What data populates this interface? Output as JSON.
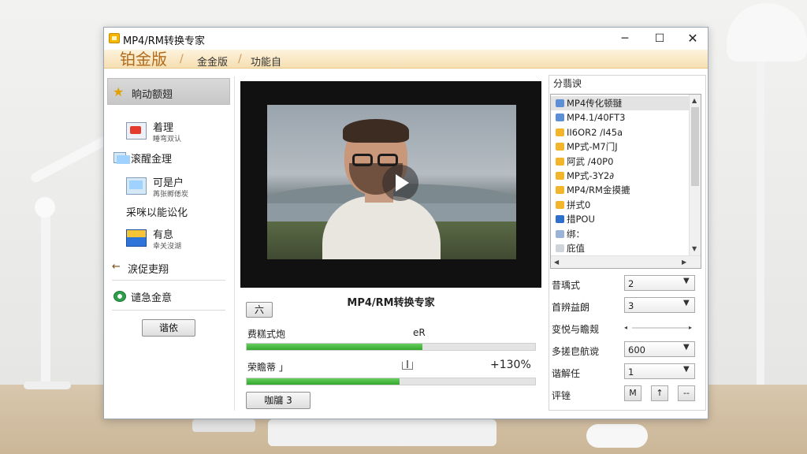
{
  "window": {
    "title": "MP4/RM转换专家",
    "min_glyph": "─",
    "max_glyph": "☐",
    "close_glyph": "✕"
  },
  "edition_bar": {
    "main_label": "铂金版",
    "tabs": [
      "金金版",
      "功能自"
    ]
  },
  "sidebar": {
    "top_label": "晌动额翅",
    "items": [
      {
        "label": "着理",
        "sub": "睡弯双认",
        "icon": "mail-icon"
      },
      {
        "label": "滚醒金理",
        "icon": "screen-small-icon"
      },
      {
        "label": "可是户",
        "sub": "苒张孵僁炭",
        "icon": "user-screen-icon"
      },
      {
        "label": "采咪以能讼化"
      },
      {
        "label": "有息",
        "sub": "幸关沒湖",
        "icon": "box-icon"
      },
      {
        "label": "涙促吏翔",
        "icon": "arrow-left-icon"
      },
      {
        "label": "谴急金意",
        "icon": "green-circle-icon"
      }
    ],
    "button_label": "谐依"
  },
  "center": {
    "video_title": "MP4/RM转换专家",
    "small_button": "六",
    "row1_label": "费糕式炮",
    "row1_value": "eR",
    "row1_progress": 0.61,
    "row2_label": "荣瞻蒂 」",
    "row2_value": "+130%",
    "row2_progress": 0.53,
    "bottom_button": "咖牖 3"
  },
  "right_panel": {
    "title": "分翡谀",
    "list": [
      {
        "label": "MP4传化顿翴",
        "icon_color": "#5c8fd6",
        "selected": true
      },
      {
        "label": "MP4.1/40FT3",
        "icon_color": "#5c8fd6"
      },
      {
        "label": "II6OR2 /I45a",
        "icon_color": "#f2b52c"
      },
      {
        "label": "MP式-M7门J",
        "icon_color": "#f2b52c"
      },
      {
        "label": "阿武 /40P0",
        "icon_color": "#f2b52c"
      },
      {
        "label": "MP式-3Y2∂",
        "icon_color": "#f2b52c"
      },
      {
        "label": "MP4/RM金摸摝",
        "icon_color": "#f2b52c"
      },
      {
        "label": "拼式0",
        "icon_color": "#f2b52c"
      },
      {
        "label": "措POU",
        "icon_color": "#2f6fcc"
      },
      {
        "label": "绑：",
        "icon_color": "#9ab3d6"
      },
      {
        "label": "庇值",
        "icon_color": "#cfd4da"
      }
    ],
    "fields": [
      {
        "label": "昔瑀式",
        "value": "2"
      },
      {
        "label": "首辨益朗",
        "value": "3"
      },
      {
        "label": "变悦与瞻觌"
      },
      {
        "label": "多搓皀航谠",
        "value": "600"
      },
      {
        "label": "谐解任",
        "value": "1"
      },
      {
        "label": "评锉",
        "buttons": [
          "M",
          "↑",
          "--"
        ]
      }
    ],
    "arrows": {
      "up": "▲",
      "down": "▼",
      "left": "◀",
      "right": "▶",
      "combo": "▼"
    }
  }
}
